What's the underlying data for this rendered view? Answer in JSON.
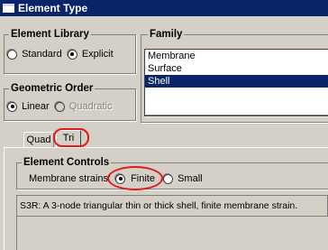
{
  "window": {
    "title": "Element Type"
  },
  "element_library": {
    "legend": "Element Library",
    "options": [
      {
        "label": "Standard",
        "selected": false
      },
      {
        "label": "Explicit",
        "selected": true
      }
    ]
  },
  "family": {
    "legend": "Family",
    "items": [
      {
        "label": "Membrane",
        "selected": false
      },
      {
        "label": "Surface",
        "selected": false
      },
      {
        "label": "Shell",
        "selected": true
      }
    ]
  },
  "geometric_order": {
    "legend": "Geometric Order",
    "options": [
      {
        "label": "Linear",
        "selected": true,
        "enabled": true
      },
      {
        "label": "Quadratic",
        "selected": false,
        "enabled": false
      }
    ]
  },
  "tabs": [
    {
      "label": "Quad",
      "active": false
    },
    {
      "label": "Tri",
      "active": true
    }
  ],
  "element_controls": {
    "legend": "Element Controls",
    "membrane_strains_label": "Membrane strains:",
    "options": [
      {
        "label": "Finite",
        "selected": true
      },
      {
        "label": "Small",
        "selected": false
      }
    ]
  },
  "description": "S3R:  A 3-node triangular thin or thick shell, finite membrane strain.",
  "colors": {
    "highlight_ring": "#e0191c",
    "selection": "#0a246a",
    "title_bar": "#0a246a"
  }
}
